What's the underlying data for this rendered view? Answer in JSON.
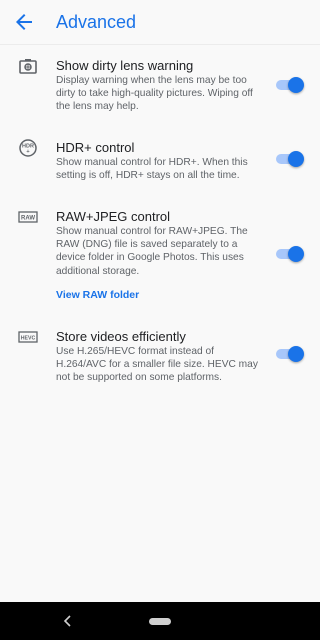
{
  "header": {
    "title": "Advanced",
    "back_icon": "arrow-back-icon"
  },
  "colors": {
    "accent": "#1a73e8",
    "track": "#a8c7fa"
  },
  "settings": [
    {
      "icon": "lens-icon",
      "title": "Show dirty lens warning",
      "description": "Display warning when the lens may be too dirty to take high-quality pictures. Wiping off the lens may help.",
      "enabled": true
    },
    {
      "icon": "hdr-plus-icon",
      "title": "HDR+ control",
      "description": "Show manual control for HDR+. When this setting is off, HDR+ stays on all the time.",
      "enabled": true
    },
    {
      "icon": "raw-icon",
      "title": "RAW+JPEG control",
      "description": "Show manual control for RAW+JPEG. The RAW (DNG) file is saved separately to a device folder in Google Photos. This uses additional storage.",
      "enabled": true,
      "link": "View RAW folder"
    },
    {
      "icon": "hevc-icon",
      "title": "Store videos efficiently",
      "description": "Use H.265/HEVC format instead of H.264/AVC for a smaller file size. HEVC may not be supported on some platforms.",
      "enabled": true
    }
  ],
  "navbar": {
    "back_icon": "nav-back-icon",
    "home_icon": "nav-home-pill-icon"
  }
}
